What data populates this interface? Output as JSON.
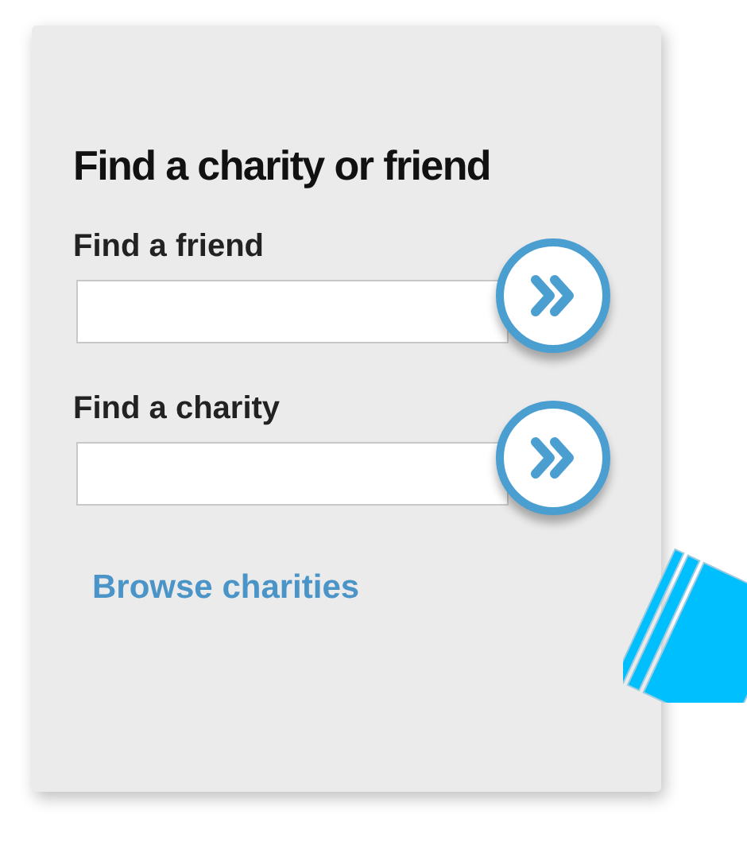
{
  "title": "Find a charity or friend",
  "searches": [
    {
      "label": "Find a friend"
    },
    {
      "label": "Find a charity"
    }
  ],
  "link": "Browse charities"
}
